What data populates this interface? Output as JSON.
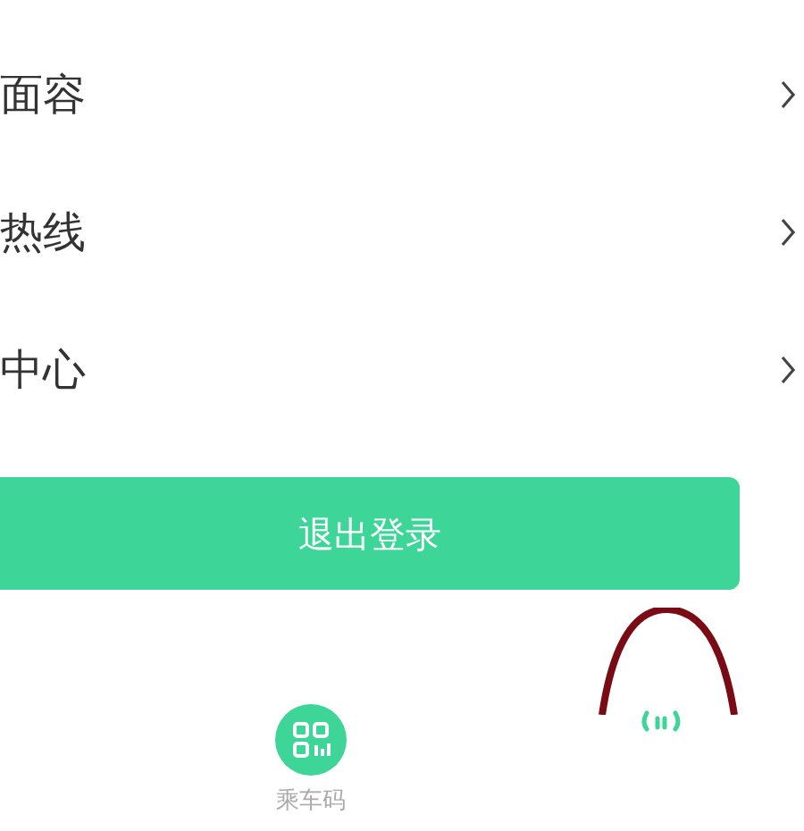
{
  "menu_items": [
    {
      "label": "面容"
    },
    {
      "label": "热线"
    },
    {
      "label": "中心"
    }
  ],
  "logout_button": {
    "label": "退出登录"
  },
  "bottom_nav": {
    "tabs": [
      {
        "label": "乘车码"
      }
    ]
  }
}
